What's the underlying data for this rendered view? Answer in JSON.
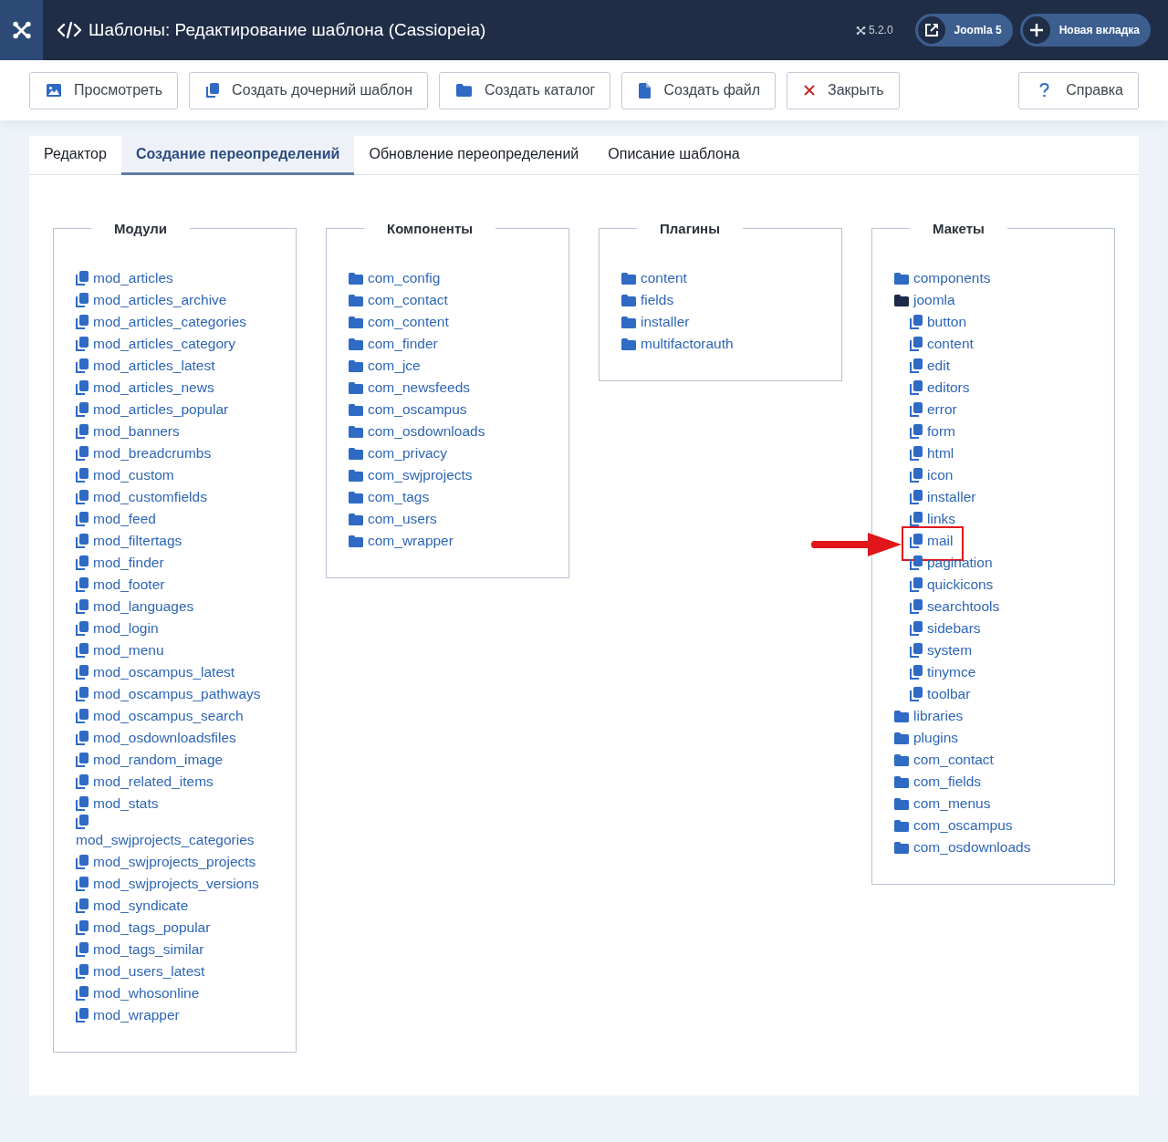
{
  "header": {
    "title": "Шаблоны: Редактирование шаблона (Cassiopeia)",
    "version": "5.2.0",
    "links": [
      {
        "label": "Joomla 5",
        "kind": "external"
      },
      {
        "label": "Новая вкладка",
        "kind": "new"
      }
    ]
  },
  "toolbar": [
    {
      "label": "Просмотреть",
      "kind": "preview"
    },
    {
      "label": "Создать дочерний шаблон",
      "kind": "copy"
    },
    {
      "label": "Создать каталог",
      "kind": "folder"
    },
    {
      "label": "Создать файл",
      "kind": "file"
    },
    {
      "label": "Закрыть",
      "kind": "close"
    },
    {
      "label": "Справка",
      "kind": "help"
    }
  ],
  "tabs": [
    {
      "label": "Редактор",
      "selected": false
    },
    {
      "label": "Создание переопределений",
      "selected": true
    },
    {
      "label": "Обновление переопределений",
      "selected": false
    },
    {
      "label": "Описание шаблона",
      "selected": false
    }
  ],
  "panels": [
    {
      "title": "Модули",
      "items": [
        {
          "label": "mod_articles",
          "kind": "file"
        },
        {
          "label": "mod_articles_archive",
          "kind": "file"
        },
        {
          "label": "mod_articles_categories",
          "kind": "file"
        },
        {
          "label": "mod_articles_category",
          "kind": "file"
        },
        {
          "label": "mod_articles_latest",
          "kind": "file"
        },
        {
          "label": "mod_articles_news",
          "kind": "file"
        },
        {
          "label": "mod_articles_popular",
          "kind": "file"
        },
        {
          "label": "mod_banners",
          "kind": "file"
        },
        {
          "label": "mod_breadcrumbs",
          "kind": "file"
        },
        {
          "label": "mod_custom",
          "kind": "file"
        },
        {
          "label": "mod_customfields",
          "kind": "file"
        },
        {
          "label": "mod_feed",
          "kind": "file"
        },
        {
          "label": "mod_filtertags",
          "kind": "file"
        },
        {
          "label": "mod_finder",
          "kind": "file"
        },
        {
          "label": "mod_footer",
          "kind": "file"
        },
        {
          "label": "mod_languages",
          "kind": "file"
        },
        {
          "label": "mod_login",
          "kind": "file"
        },
        {
          "label": "mod_menu",
          "kind": "file"
        },
        {
          "label": "mod_oscampus_latest",
          "kind": "file"
        },
        {
          "label": "mod_oscampus_pathways",
          "kind": "file"
        },
        {
          "label": "mod_oscampus_search",
          "kind": "file"
        },
        {
          "label": "mod_osdownloadsfiles",
          "kind": "file"
        },
        {
          "label": "mod_random_image",
          "kind": "file"
        },
        {
          "label": "mod_related_items",
          "kind": "file"
        },
        {
          "label": "mod_stats",
          "kind": "file"
        },
        {
          "label": "mod_swjprojects_categories",
          "kind": "file"
        },
        {
          "label": "mod_swjprojects_projects",
          "kind": "file"
        },
        {
          "label": "mod_swjprojects_versions",
          "kind": "file"
        },
        {
          "label": "mod_syndicate",
          "kind": "file"
        },
        {
          "label": "mod_tags_popular",
          "kind": "file"
        },
        {
          "label": "mod_tags_similar",
          "kind": "file"
        },
        {
          "label": "mod_users_latest",
          "kind": "file"
        },
        {
          "label": "mod_whosonline",
          "kind": "file"
        },
        {
          "label": "mod_wrapper",
          "kind": "file"
        }
      ]
    },
    {
      "title": "Компоненты",
      "items": [
        {
          "label": "com_config",
          "kind": "folder"
        },
        {
          "label": "com_contact",
          "kind": "folder"
        },
        {
          "label": "com_content",
          "kind": "folder"
        },
        {
          "label": "com_finder",
          "kind": "folder"
        },
        {
          "label": "com_jce",
          "kind": "folder"
        },
        {
          "label": "com_newsfeeds",
          "kind": "folder"
        },
        {
          "label": "com_oscampus",
          "kind": "folder"
        },
        {
          "label": "com_osdownloads",
          "kind": "folder"
        },
        {
          "label": "com_privacy",
          "kind": "folder"
        },
        {
          "label": "com_swjprojects",
          "kind": "folder"
        },
        {
          "label": "com_tags",
          "kind": "folder"
        },
        {
          "label": "com_users",
          "kind": "folder"
        },
        {
          "label": "com_wrapper",
          "kind": "folder"
        }
      ]
    },
    {
      "title": "Плагины",
      "items": [
        {
          "label": "content",
          "kind": "folder"
        },
        {
          "label": "fields",
          "kind": "folder"
        },
        {
          "label": "installer",
          "kind": "folder"
        },
        {
          "label": "multifactorauth",
          "kind": "folder"
        }
      ]
    },
    {
      "title": "Макеты",
      "items": [
        {
          "label": "components",
          "kind": "folder",
          "expanded": false
        },
        {
          "label": "joomla",
          "kind": "folder",
          "expanded": true,
          "children": [
            {
              "label": "button",
              "kind": "file",
              "highlighted": false
            },
            {
              "label": "content",
              "kind": "file",
              "highlighted": false
            },
            {
              "label": "edit",
              "kind": "file",
              "highlighted": false
            },
            {
              "label": "editors",
              "kind": "file",
              "highlighted": false
            },
            {
              "label": "error",
              "kind": "file",
              "highlighted": false
            },
            {
              "label": "form",
              "kind": "file",
              "highlighted": false
            },
            {
              "label": "html",
              "kind": "file",
              "highlighted": false
            },
            {
              "label": "icon",
              "kind": "file",
              "highlighted": false
            },
            {
              "label": "installer",
              "kind": "file",
              "highlighted": false
            },
            {
              "label": "links",
              "kind": "file",
              "highlighted": false
            },
            {
              "label": "mail",
              "kind": "file",
              "highlighted": true
            },
            {
              "label": "pagination",
              "kind": "file",
              "highlighted": false
            },
            {
              "label": "quickicons",
              "kind": "file",
              "highlighted": false
            },
            {
              "label": "searchtools",
              "kind": "file",
              "highlighted": false
            },
            {
              "label": "sidebars",
              "kind": "file",
              "highlighted": false
            },
            {
              "label": "system",
              "kind": "file",
              "highlighted": false
            },
            {
              "label": "tinymce",
              "kind": "file",
              "highlighted": false
            },
            {
              "label": "toolbar",
              "kind": "file",
              "highlighted": false
            }
          ]
        },
        {
          "label": "libraries",
          "kind": "folder",
          "expanded": false
        },
        {
          "label": "plugins",
          "kind": "folder",
          "expanded": false
        },
        {
          "label": "com_contact",
          "kind": "folder",
          "expanded": false
        },
        {
          "label": "com_fields",
          "kind": "folder",
          "expanded": false
        },
        {
          "label": "com_menus",
          "kind": "folder",
          "expanded": false
        },
        {
          "label": "com_oscampus",
          "kind": "folder",
          "expanded": false
        },
        {
          "label": "com_osdownloads",
          "kind": "folder",
          "expanded": false
        }
      ]
    }
  ]
}
